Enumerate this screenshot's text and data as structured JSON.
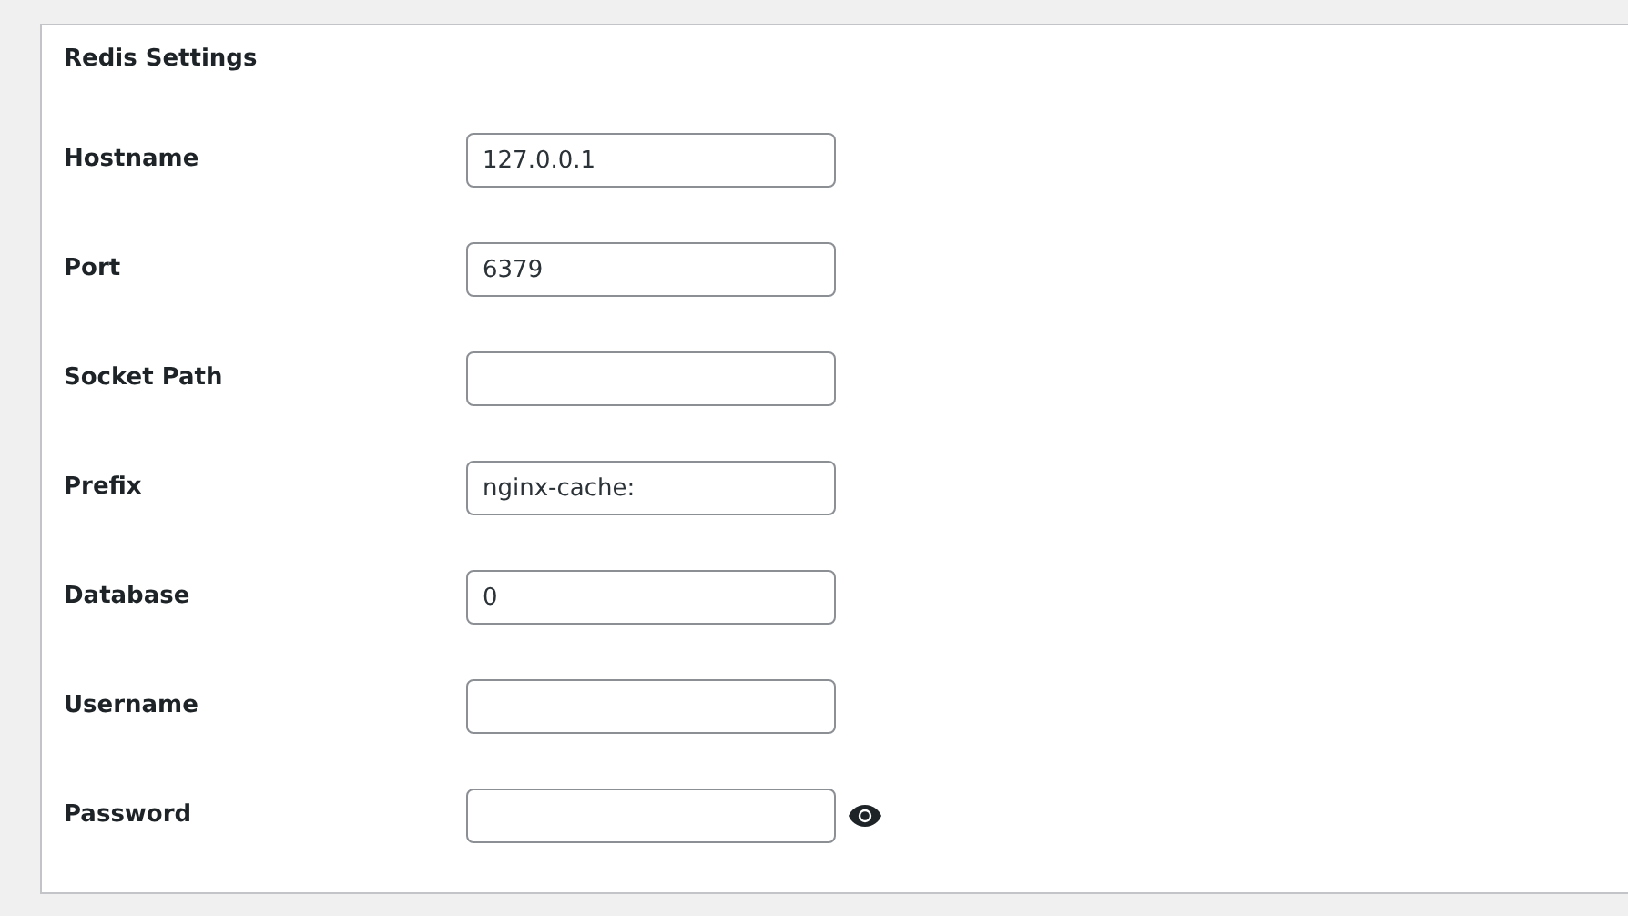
{
  "panel": {
    "title": "Redis Settings"
  },
  "fields": [
    {
      "label": "Hostname",
      "value": "127.0.0.1",
      "kind": "text"
    },
    {
      "label": "Port",
      "value": "6379",
      "kind": "text"
    },
    {
      "label": "Socket Path",
      "kind": "text"
    },
    {
      "label": "Prefix",
      "value": "nginx-cache:",
      "kind": "text"
    },
    {
      "label": "Database",
      "value": "0",
      "kind": "text"
    },
    {
      "label": "Username",
      "kind": "text"
    },
    {
      "label": "Password",
      "kind": "password"
    }
  ]
}
